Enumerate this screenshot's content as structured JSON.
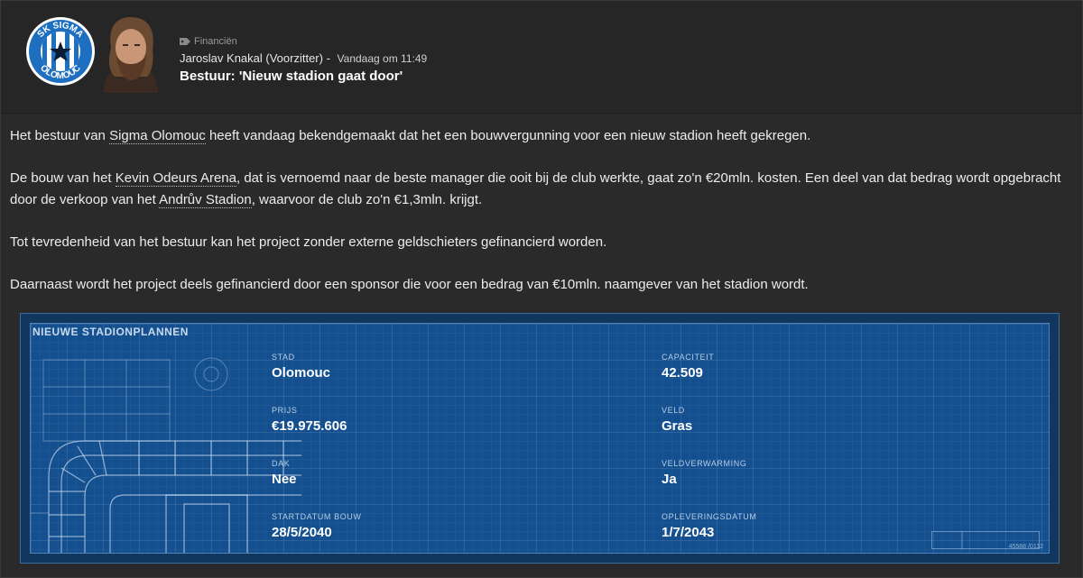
{
  "message": {
    "category": "Financiën",
    "sender": "Jaroslav Knakal (Voorzitter)",
    "separator": "-",
    "time": "Vandaag om 11:49",
    "subject": "Bestuur: 'Nieuw stadion gaat door'"
  },
  "club_logo": {
    "top_text": "SK SIGMA",
    "bottom_text": "OLOMOUC",
    "colors": {
      "blue": "#1f6fc0",
      "white": "#ffffff",
      "dark": "#0b1b33"
    }
  },
  "body": {
    "p1": {
      "before": "Het bestuur van ",
      "club_link": "Sigma Olomouc",
      "after": " heeft vandaag bekendgemaakt dat het een bouwvergunning voor een nieuw stadion heeft gekregen."
    },
    "p2": {
      "t1": "De bouw van het ",
      "new_stadium_link": "Kevin Odeurs Arena",
      "t2": ", dat is vernoemd naar de beste manager die ooit bij de club werkte, gaat zo'n €20mln. kosten. Een deel van dat bedrag wordt opgebracht door de verkoop van het ",
      "old_stadium_link": "Andrův Stadion",
      "t3": ", waarvoor de club zo'n €1,3mln. krijgt."
    },
    "p3": "Tot tevredenheid van het bestuur kan het project zonder externe geldschieters gefinancierd worden.",
    "p4": "Daarnaast wordt het project deels gefinancierd door een sponsor die voor een bedrag van €10mln. naamgever van het stadion wordt."
  },
  "plan": {
    "title": "NIEUWE STADIONPLANNEN",
    "stad": {
      "label": "STAD",
      "value": "Olomouc"
    },
    "prijs": {
      "label": "PRIJS",
      "value": "€19.975.606"
    },
    "dak": {
      "label": "DAK",
      "value": "Nee"
    },
    "startdatum": {
      "label": "STARTDATUM BOUW",
      "value": "28/5/2040"
    },
    "capaciteit": {
      "label": "CAPACITEIT",
      "value": "42.509"
    },
    "veld": {
      "label": "VELD",
      "value": "Gras"
    },
    "veldverwarming": {
      "label": "VELDVERWARMING",
      "value": "Ja"
    },
    "oplevering": {
      "label": "OPLEVERINGSDATUM",
      "value": "1/7/2043"
    },
    "stamp": "45588 /0112"
  },
  "icons": {
    "category": "tag-icon",
    "avatar": "person-avatar"
  }
}
